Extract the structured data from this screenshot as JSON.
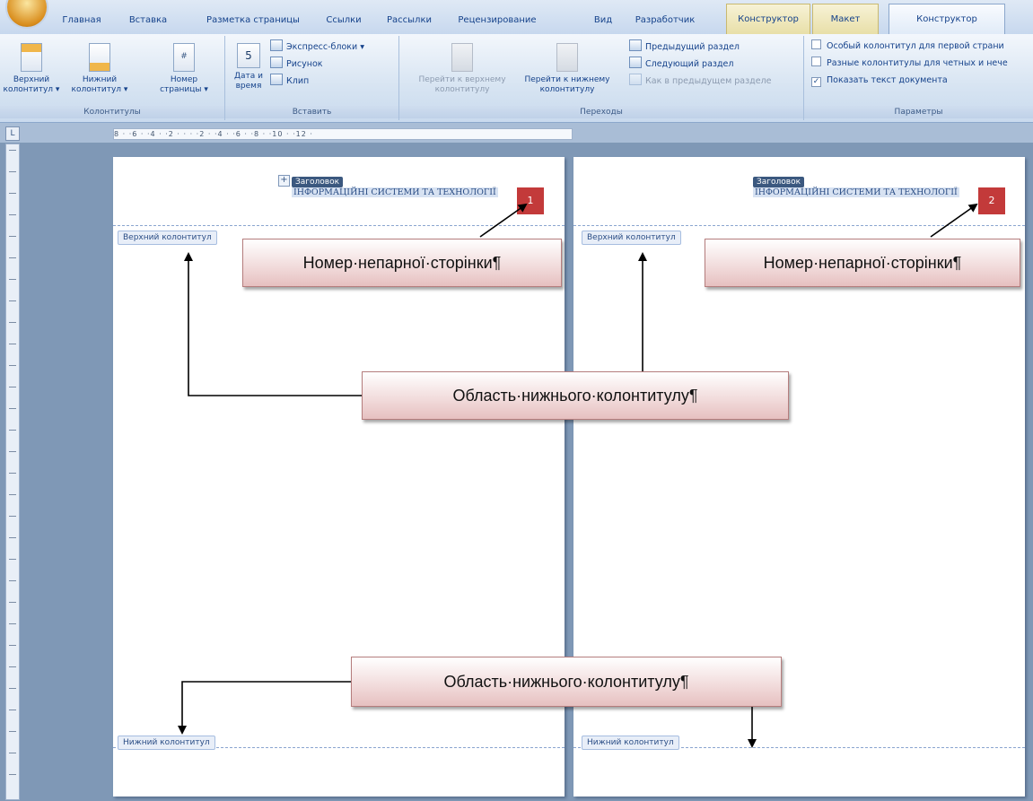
{
  "tabs": [
    "Главная",
    "Вставка",
    "Разметка страницы",
    "Ссылки",
    "Рассылки",
    "Рецензирование",
    "Вид",
    "Разработчик",
    "Конструктор",
    "Макет",
    "Конструктор"
  ],
  "ribbon": {
    "groups": {
      "kolontituly": {
        "label": "Колонтитулы",
        "buttons": [
          "Верхний колонтитул ▾",
          "Нижний колонтитул ▾",
          "Номер страницы ▾"
        ]
      },
      "vstavit": {
        "label": "Вставить",
        "date_button": "Дата и время",
        "small": [
          "Экспресс-блоки ▾",
          "Рисунок",
          "Клип"
        ]
      },
      "perehody": {
        "label": "Переходы",
        "goto_header": "Перейти к верхнему колонтитулу",
        "goto_footer": "Перейти к нижнему колонтитулу",
        "small": [
          "Предыдущий раздел",
          "Следующий раздел",
          "Как в предыдущем разделе"
        ]
      },
      "parametry": {
        "label": "Параметры",
        "options": [
          {
            "label": "Особый колонтитул для первой страни",
            "checked": false
          },
          {
            "label": "Разные колонтитулы для четных и нечe",
            "checked": false
          },
          {
            "label": "Показать текст документа",
            "checked": true
          }
        ]
      }
    }
  },
  "ruler": {
    "text": "8 ·  ·6 ·  ·4 ·  ·2 ·  ·  ·   ·2 ·  ·4 ·  ·6 ·  ·8 ·  ·10 ·  ·12 ·",
    "corner": "L"
  },
  "pages": [
    {
      "title_tag": "Заголовок",
      "title_text": "ІНФОРМАЦІЙНІ СИСТЕМИ ТА ТЕХНОЛОГІЇ",
      "page_number": "1",
      "header_tag": "Верхний колонтитул",
      "footer_tag": "Нижний колонтитул"
    },
    {
      "title_tag": "Заголовок",
      "title_text": "ІНФОРМАЦІЙНІ СИСТЕМИ ТА ТЕХНОЛОГІЇ",
      "page_number": "2",
      "header_tag": "Верхний колонтитул",
      "footer_tag": "Нижний колонтитул"
    }
  ],
  "callouts": {
    "odd_page_left": "Номер·непарної·сторінки¶",
    "odd_page_right": "Номер·непарної·сторінки¶",
    "middle": "Область·нижнього·колонтитулу¶",
    "bottom": "Область·нижнього·колонтитулу¶"
  }
}
